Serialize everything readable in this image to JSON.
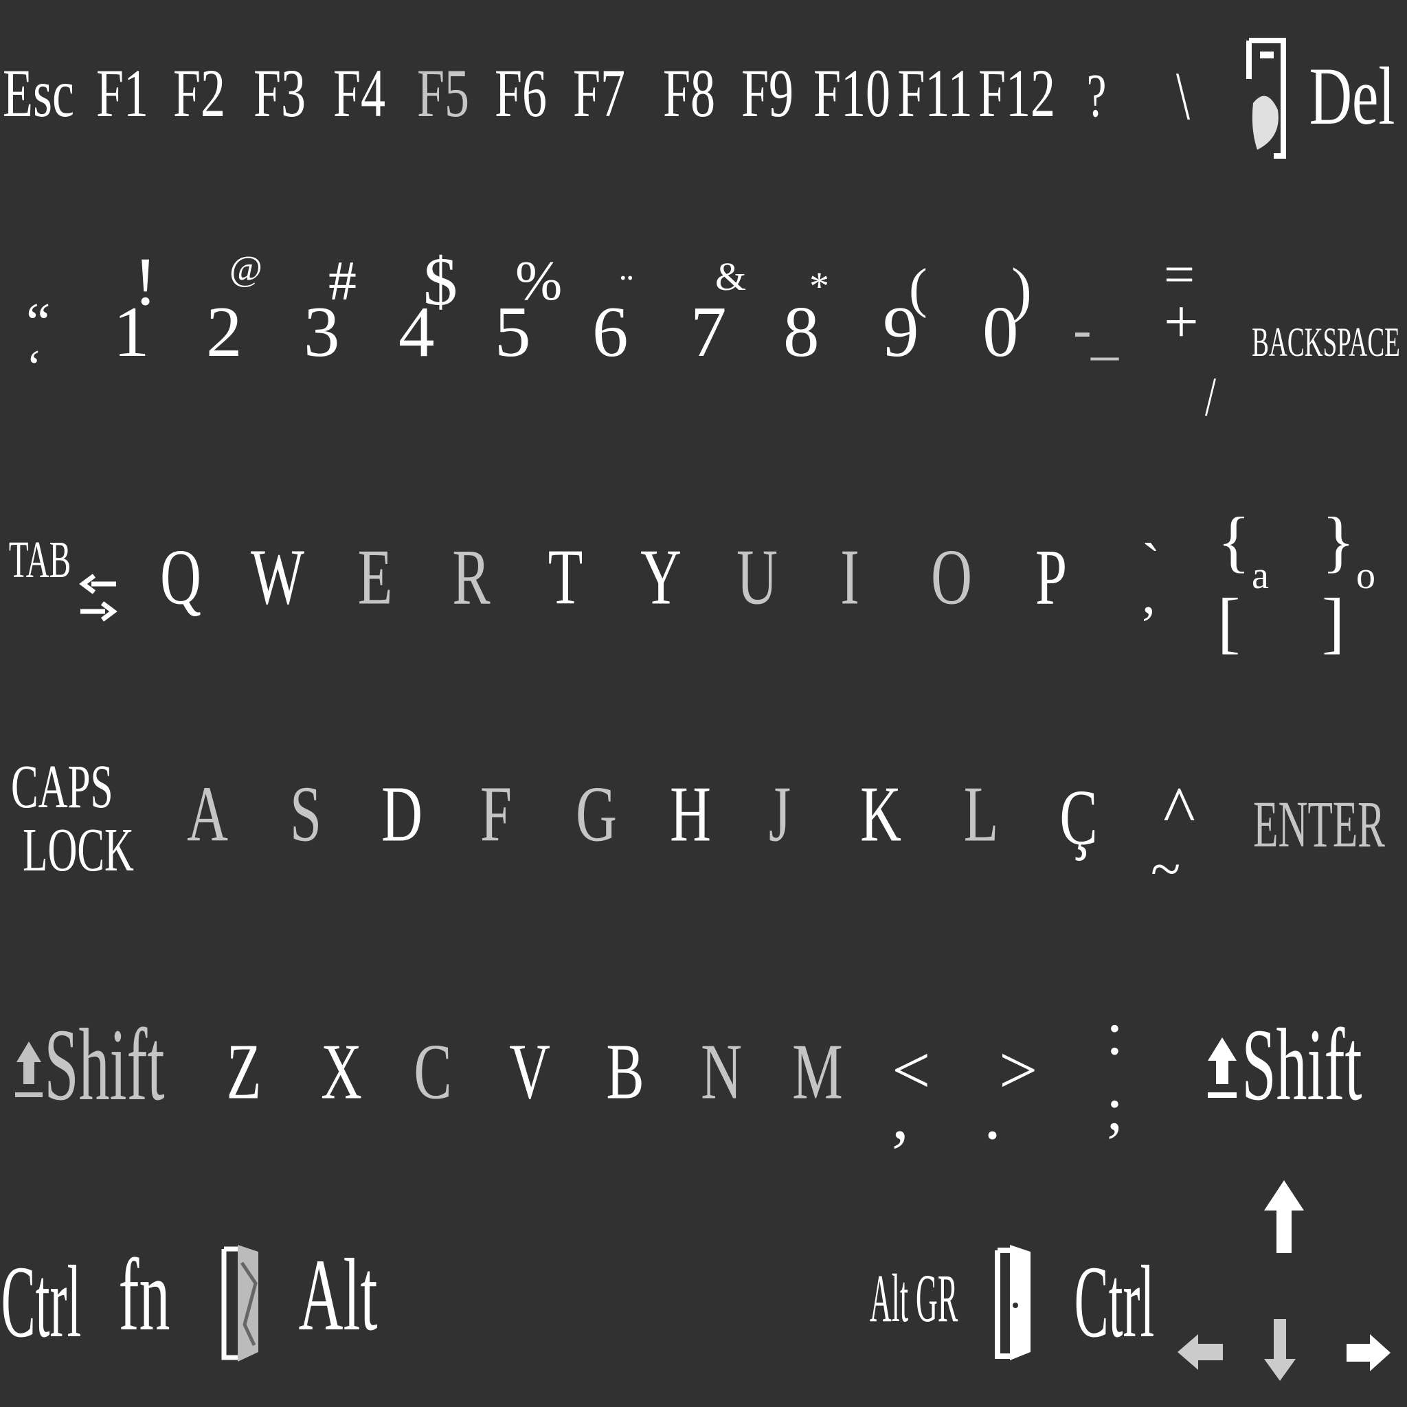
{
  "colors": {
    "background": "#313131",
    "key_label": "#ffffff"
  },
  "row_function": {
    "esc": "Esc",
    "f_keys": [
      "F1",
      "F2",
      "F3",
      "F4",
      "F5",
      "F6",
      "F7",
      "F8",
      "F9",
      "F10",
      "F11",
      "F12"
    ],
    "question": "?",
    "backslash": "\\",
    "print_icon": "print-screen-icon",
    "del": "Del"
  },
  "row_numbers": {
    "keys": [
      {
        "lo": "‘",
        "hi": "“"
      },
      {
        "lo": "1",
        "hi": "!"
      },
      {
        "lo": "2",
        "hi": "@"
      },
      {
        "lo": "3",
        "hi": "#"
      },
      {
        "lo": "4",
        "hi": "$"
      },
      {
        "lo": "5",
        "hi": "%"
      },
      {
        "lo": "6",
        "hi": "¨"
      },
      {
        "lo": "7",
        "hi": "&"
      },
      {
        "lo": "8",
        "hi": "*"
      },
      {
        "lo": "9",
        "hi": "("
      },
      {
        "lo": "0",
        "hi": ")"
      },
      {
        "lo": "-",
        "hi": "_"
      },
      {
        "lo": "=",
        "hi": "+"
      }
    ],
    "slash": "/",
    "backspace": "BACKSPACE"
  },
  "row_qwerty": {
    "tab": "TAB",
    "tab_icon": "tab-arrows-icon",
    "letters": [
      "Q",
      "W",
      "E",
      "R",
      "T",
      "Y",
      "U",
      "I",
      "O",
      "P"
    ],
    "acute_key": {
      "hi": "`",
      "lo": ","
    },
    "brace_left": {
      "hi": "{",
      "lo": "[",
      "side": "a"
    },
    "brace_right": {
      "hi": "}",
      "lo": "]",
      "side": "o"
    }
  },
  "row_home": {
    "caps": [
      "CAPS",
      "LOCK"
    ],
    "letters": [
      "A",
      "S",
      "D",
      "F",
      "G",
      "H",
      "J",
      "K",
      "L",
      "Ç"
    ],
    "tilde_key": {
      "hi": "^",
      "lo": "~"
    },
    "enter": "ENTER"
  },
  "row_bottom_letters": {
    "shift_left": "Shift",
    "letters": [
      "Z",
      "X",
      "C",
      "V",
      "B",
      "N",
      "M"
    ],
    "comma_key": {
      "hi": "<",
      "lo": ","
    },
    "period_key": {
      "hi": ">",
      "lo": "."
    },
    "semicolon_key": {
      "hi": ":",
      "lo": ";"
    },
    "shift_right": "Shift",
    "shift_icon": "shift-arrow-icon"
  },
  "row_modifiers": {
    "ctrl_left": "Ctrl",
    "fn": "fn",
    "windows_icon": "windows-door-icon",
    "alt": "Alt",
    "altgr": "Alt GR",
    "menu_icon": "menu-door-icon",
    "ctrl_right": "Ctrl",
    "arrows": [
      "arrow-up-icon",
      "arrow-left-icon",
      "arrow-down-icon",
      "arrow-right-icon"
    ]
  }
}
